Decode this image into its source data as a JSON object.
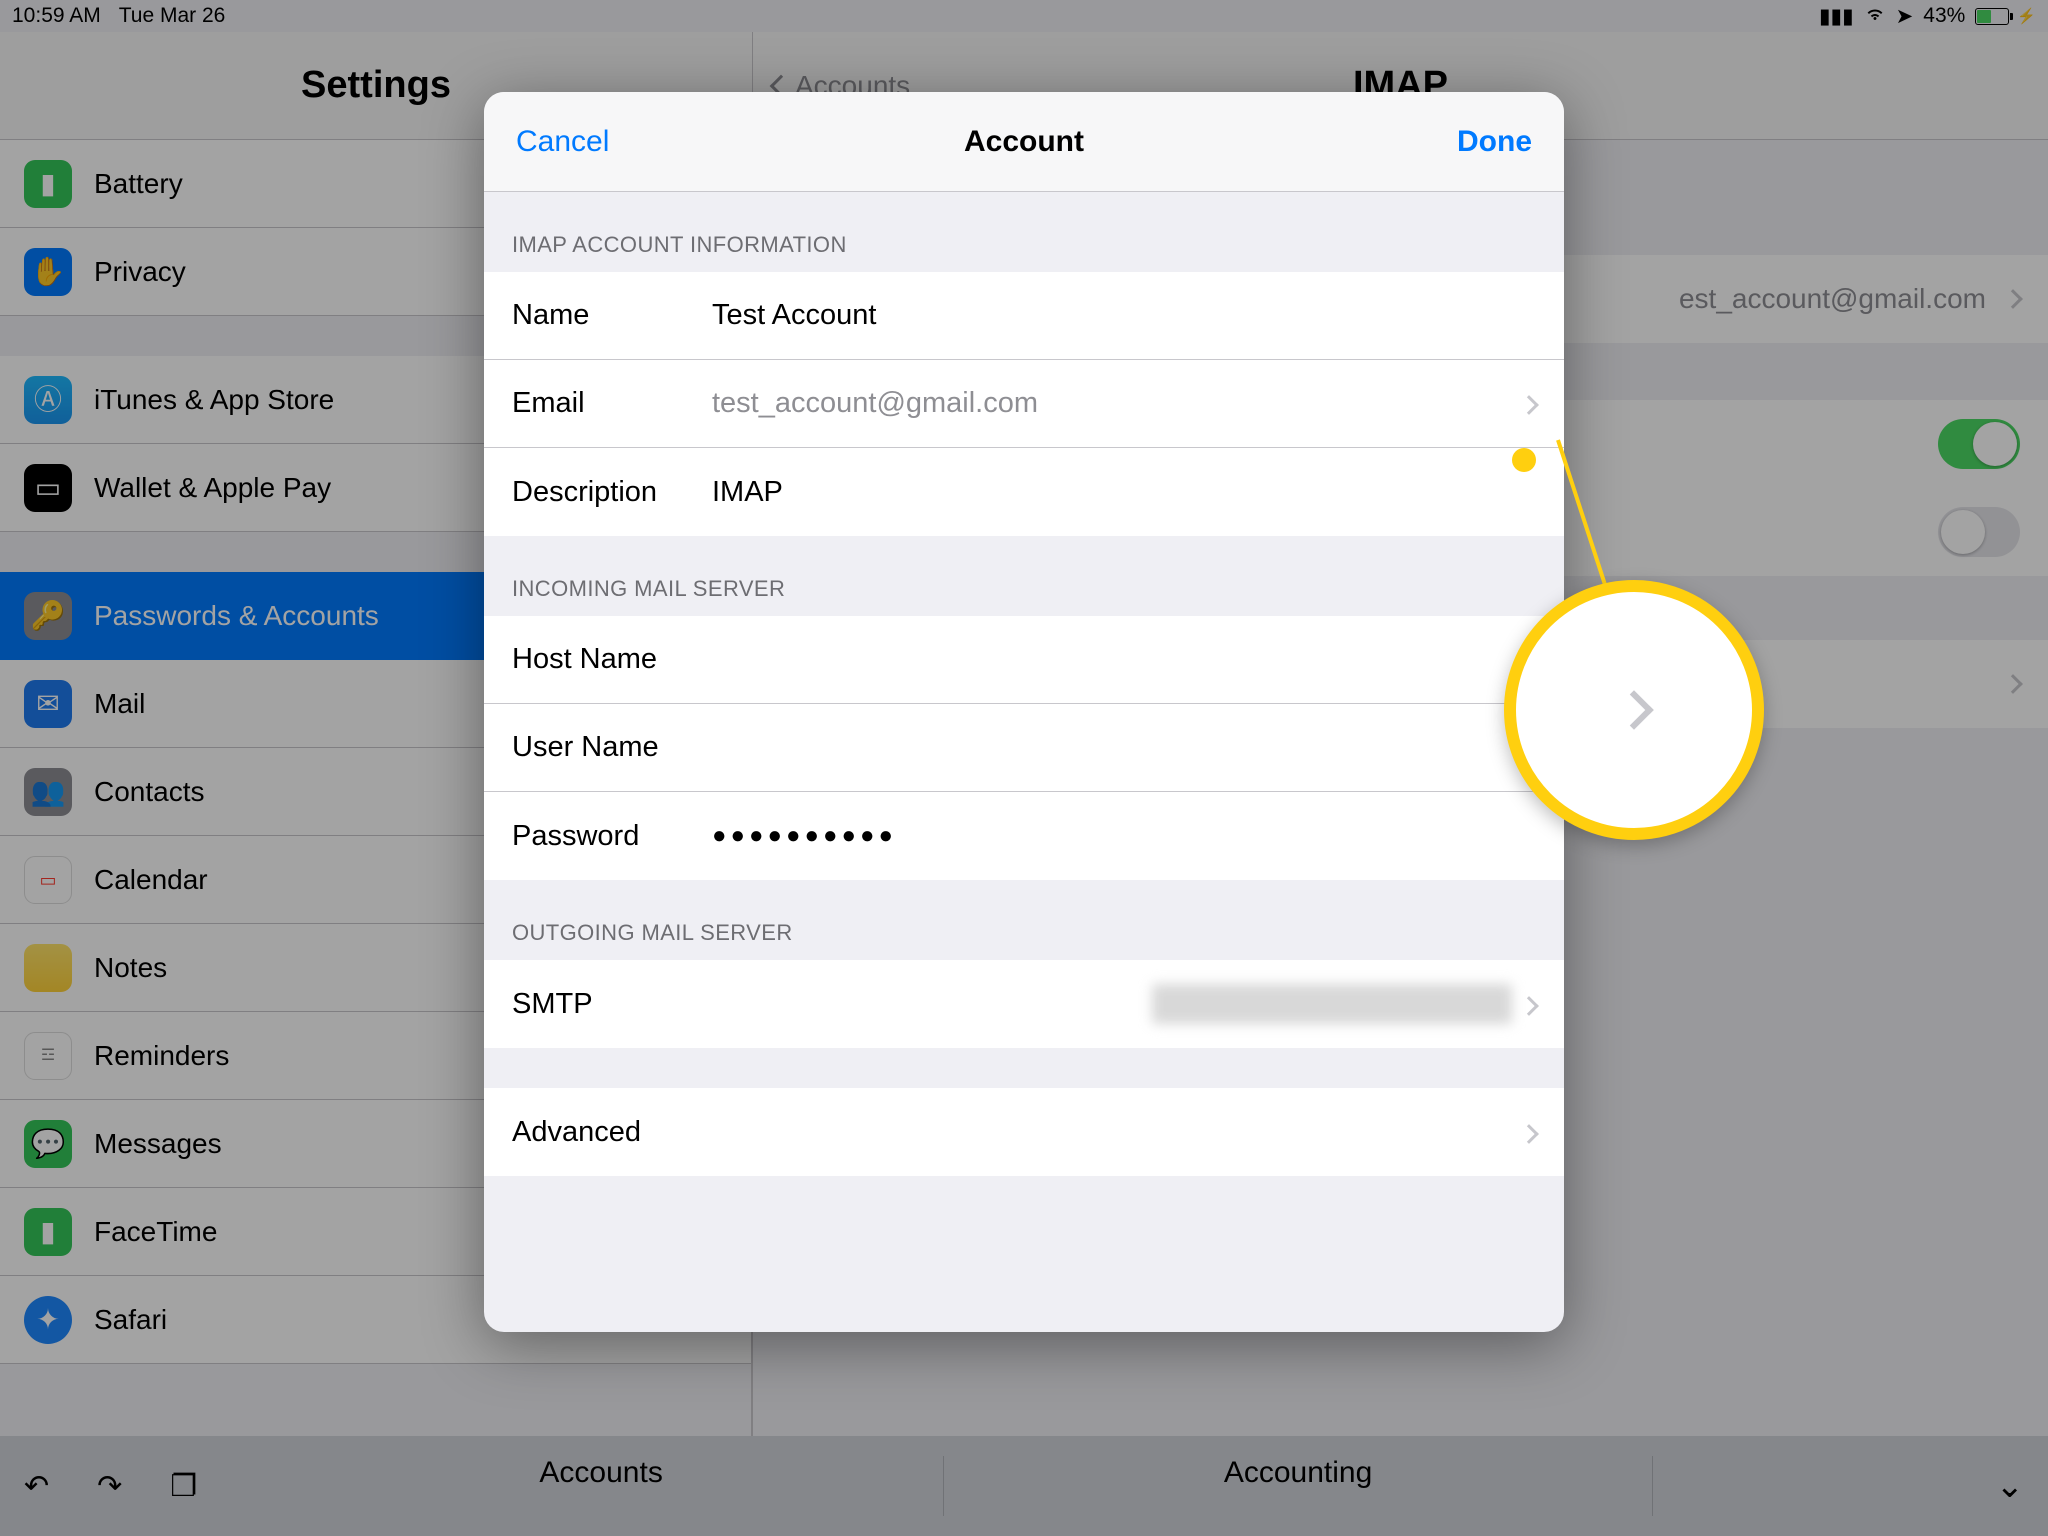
{
  "status": {
    "time": "10:59 AM",
    "date": "Tue Mar 26",
    "battery_pct": "43%"
  },
  "settings_title": "Settings",
  "detail": {
    "back_label": "Accounts",
    "title": "IMAP",
    "account_email": "est_account@gmail.com"
  },
  "sidebar": {
    "battery": "Battery",
    "privacy": "Privacy",
    "itunes": "iTunes & App Store",
    "wallet": "Wallet & Apple Pay",
    "passwords": "Passwords & Accounts",
    "mail": "Mail",
    "contacts": "Contacts",
    "calendar": "Calendar",
    "notes": "Notes",
    "reminders": "Reminders",
    "messages": "Messages",
    "facetime": "FaceTime",
    "safari": "Safari"
  },
  "modal": {
    "cancel": "Cancel",
    "title": "Account",
    "done": "Done",
    "sections": {
      "imap_info": "IMAP ACCOUNT INFORMATION",
      "incoming": "INCOMING MAIL SERVER",
      "outgoing": "OUTGOING MAIL SERVER"
    },
    "fields": {
      "name_label": "Name",
      "name_value": "Test Account",
      "email_label": "Email",
      "email_value": "test_account@gmail.com",
      "description_label": "Description",
      "description_value": "IMAP",
      "host_label": "Host Name",
      "user_label": "User Name",
      "password_label": "Password",
      "password_value": "●●●●●●●●●●",
      "smtp_label": "SMTP",
      "advanced_label": "Advanced"
    }
  },
  "kb": {
    "suggestion1": "Accounts",
    "suggestion2": "Accounting"
  }
}
